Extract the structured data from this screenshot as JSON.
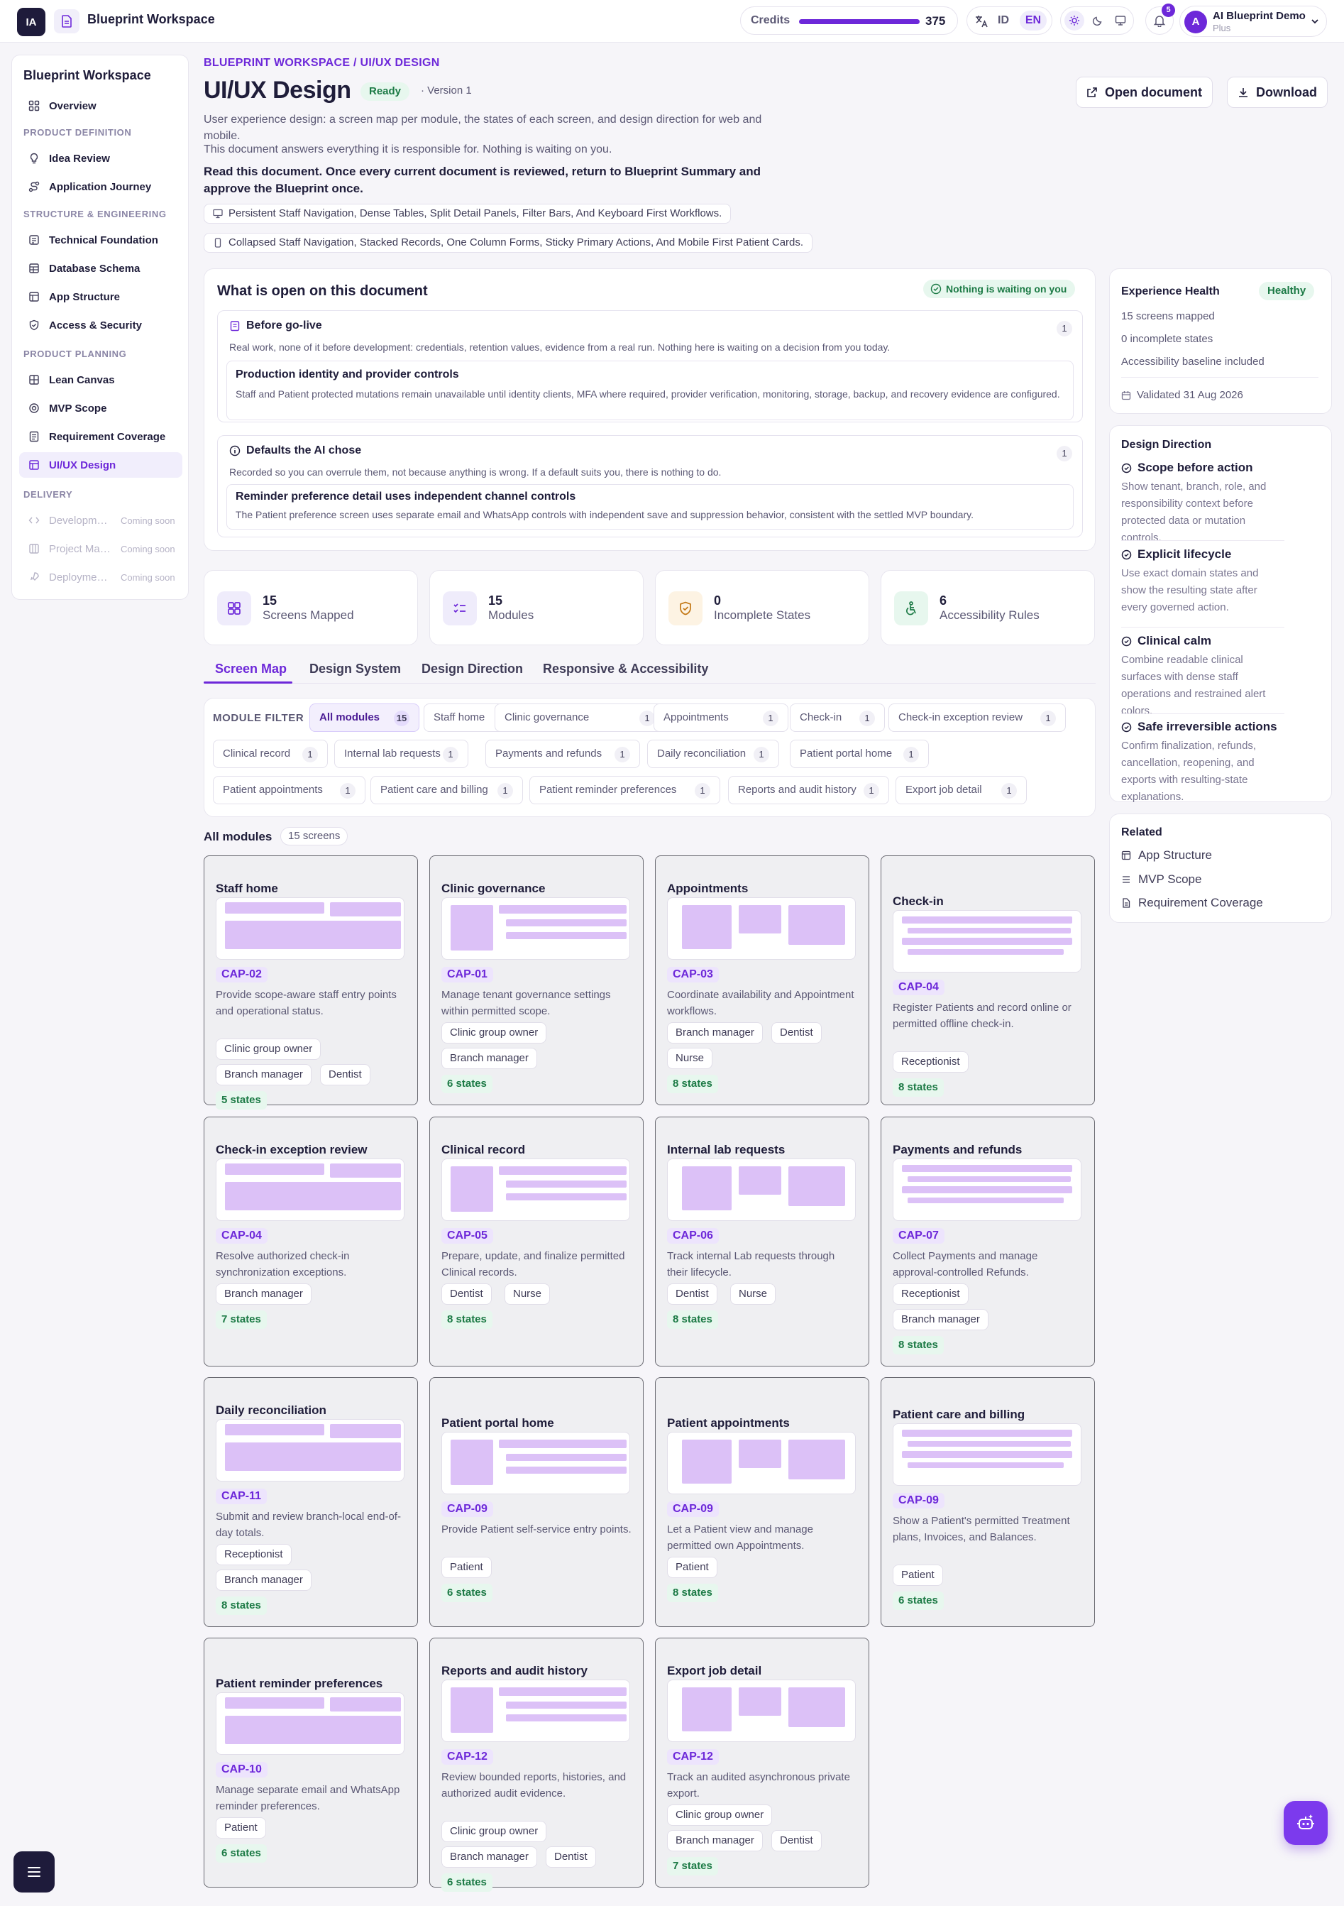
{
  "topbar": {
    "logo": "IA",
    "workspace": "Blueprint Workspace",
    "credits_label": "Credits",
    "credits_value": "375",
    "credits_level": 1.0,
    "lang_id": "ID",
    "lang_en": "EN",
    "notifications": "5",
    "user_initial": "A",
    "user_name": "AI Blueprint Demo",
    "user_plan": "Plus"
  },
  "sidebar": {
    "title": "Blueprint Workspace",
    "overview": "Overview",
    "sections": {
      "product_definition": "PRODUCT DEFINITION",
      "structure": "STRUCTURE & ENGINEERING",
      "planning": "PRODUCT PLANNING",
      "delivery": "DELIVERY"
    },
    "items": {
      "idea_review": "Idea Review",
      "application_journey": "Application Journey",
      "technical_foundation": "Technical Foundation",
      "database_schema": "Database Schema",
      "app_structure": "App Structure",
      "access_security": "Access & Security",
      "lean_canvas": "Lean Canvas",
      "mvp_scope": "MVP Scope",
      "requirement_coverage": "Requirement Coverage",
      "uiux_design": "UI/UX Design"
    },
    "delivery": [
      {
        "label": "Developm…",
        "soon": "Coming soon"
      },
      {
        "label": "Project Ma…",
        "soon": "Coming soon"
      },
      {
        "label": "Deployme…",
        "soon": "Coming soon"
      }
    ]
  },
  "header": {
    "breadcrumb": "BLUEPRINT WORKSPACE / UI/UX DESIGN",
    "title": "UI/UX Design",
    "status": "Ready",
    "version": "· Version 1",
    "open_button": "Open document",
    "download_button": "Download",
    "description": "User experience design: a screen map per module, the states of each screen, and design direction for web and mobile.",
    "description2": "This document answers everything it is responsible for. Nothing is waiting on you.",
    "instruction": "Read this document. Once every current document is reviewed, return to Blueprint Summary and approve the Blueprint once.",
    "desktop_pill": "Persistent Staff Navigation, Dense Tables, Split Detail Panels, Filter Bars, And Keyboard First Workflows.",
    "mobile_pill": "Collapsed Staff Navigation, Stacked Records, One Column Forms, Sticky Primary Actions, And Mobile First Patient Cards."
  },
  "open_items": {
    "title": "What is open on this document",
    "badge": "Nothing is waiting on you",
    "golive": {
      "title": "Before go-live",
      "count": "1",
      "sub": "Real work, none of it before development: credentials, retention values, evidence from a real run. Nothing here is waiting on a decision from you today.",
      "item_title": "Production identity and provider controls",
      "item_body": "Staff and Patient protected mutations remain unavailable until identity clients, MFA where required, provider verification, monitoring, storage, backup, and recovery evidence are configured."
    },
    "defaults": {
      "title": "Defaults the AI chose",
      "count": "1",
      "sub": "Recorded so you can overrule them, not because anything is wrong. If a default suits you, there is nothing to do.",
      "item_title": "Reminder preference detail uses independent channel controls",
      "item_body": "The Patient preference screen uses separate email and WhatsApp controls with independent save and suppression behavior, consistent with the settled MVP boundary."
    }
  },
  "stats": [
    {
      "value": "15",
      "label": "Screens Mapped"
    },
    {
      "value": "15",
      "label": "Modules"
    },
    {
      "value": "0",
      "label": "Incomplete States"
    },
    {
      "value": "6",
      "label": "Accessibility Rules"
    }
  ],
  "tabs": [
    "Screen Map",
    "Design System",
    "Design Direction",
    "Responsive & Accessibility"
  ],
  "filter": {
    "label": "MODULE FILTER",
    "chips": [
      {
        "label": "All modules",
        "count": "15"
      },
      {
        "label": "Staff home",
        "count": "1"
      },
      {
        "label": "Clinic governance",
        "count": "1"
      },
      {
        "label": "Appointments",
        "count": "1"
      },
      {
        "label": "Check-in",
        "count": "1"
      },
      {
        "label": "Check-in exception review",
        "count": "1"
      },
      {
        "label": "Clinical record",
        "count": "1"
      },
      {
        "label": "Internal lab requests",
        "count": "1"
      },
      {
        "label": "Payments and refunds",
        "count": "1"
      },
      {
        "label": "Daily reconciliation",
        "count": "1"
      },
      {
        "label": "Patient portal home",
        "count": "1"
      },
      {
        "label": "Patient appointments",
        "count": "1"
      },
      {
        "label": "Patient care and billing",
        "count": "1"
      },
      {
        "label": "Patient reminder preferences",
        "count": "1"
      },
      {
        "label": "Reports and audit history",
        "count": "1"
      },
      {
        "label": "Export job detail",
        "count": "1"
      }
    ]
  },
  "modules_header": {
    "title": "All modules",
    "count": "15 screens"
  },
  "modules": [
    {
      "title": "Staff home",
      "cap": "CAP-02",
      "desc": "Provide scope-aware staff entry points and operational status.",
      "roles": [
        "Clinic group owner",
        "Branch manager",
        "Dentist"
      ],
      "states": "5 states"
    },
    {
      "title": "Clinic governance",
      "cap": "CAP-01",
      "desc": "Manage tenant governance settings within permitted scope.",
      "roles": [
        "Clinic group owner",
        "Branch manager"
      ],
      "states": "6 states"
    },
    {
      "title": "Appointments",
      "cap": "CAP-03",
      "desc": "Coordinate availability and Appointment workflows.",
      "roles": [
        "Branch manager",
        "Dentist",
        "Nurse"
      ],
      "states": "8 states"
    },
    {
      "title": "Check-in",
      "cap": "CAP-04",
      "desc": "Register Patients and record online or permitted offline check-in.",
      "roles": [
        "Receptionist"
      ],
      "states": "8 states"
    },
    {
      "title": "Check-in exception review",
      "cap": "CAP-04",
      "desc": "Resolve authorized check-in synchronization exceptions.",
      "roles": [
        "Branch manager"
      ],
      "states": "7 states"
    },
    {
      "title": "Clinical record",
      "cap": "CAP-05",
      "desc": "Prepare, update, and finalize permitted Clinical records.",
      "roles": [
        "Dentist",
        "Nurse"
      ],
      "states": "8 states"
    },
    {
      "title": "Internal lab requests",
      "cap": "CAP-06",
      "desc": "Track internal Lab requests through their lifecycle.",
      "roles": [
        "Dentist",
        "Nurse"
      ],
      "states": "8 states"
    },
    {
      "title": "Payments and refunds",
      "cap": "CAP-07",
      "desc": "Collect Payments and manage approval-controlled Refunds.",
      "roles": [
        "Receptionist",
        "Branch manager"
      ],
      "states": "8 states"
    },
    {
      "title": "Daily reconciliation",
      "cap": "CAP-11",
      "desc": "Submit and review branch-local end-of-day totals.",
      "roles": [
        "Receptionist",
        "Branch manager"
      ],
      "states": "8 states"
    },
    {
      "title": "Patient portal home",
      "cap": "CAP-09",
      "desc": "Provide Patient self-service entry points.",
      "roles": [
        "Patient"
      ],
      "states": "6 states"
    },
    {
      "title": "Patient appointments",
      "cap": "CAP-09",
      "desc": "Let a Patient view and manage permitted own Appointments.",
      "roles": [
        "Patient"
      ],
      "states": "8 states"
    },
    {
      "title": "Patient care and billing",
      "cap": "CAP-09",
      "desc": "Show a Patient's permitted Treatment plans, Invoices, and Balances.",
      "roles": [
        "Patient"
      ],
      "states": "6 states"
    },
    {
      "title": "Patient reminder preferences",
      "cap": "CAP-10",
      "desc": "Manage separate email and WhatsApp reminder preferences.",
      "roles": [
        "Patient"
      ],
      "states": "6 states"
    },
    {
      "title": "Reports and audit history",
      "cap": "CAP-12",
      "desc": "Review bounded reports, histories, and authorized audit evidence.",
      "roles": [
        "Clinic group owner",
        "Branch manager",
        "Dentist"
      ],
      "states": "6 states"
    },
    {
      "title": "Export job detail",
      "cap": "CAP-12",
      "desc": "Track an audited asynchronous private export.",
      "roles": [
        "Clinic group owner",
        "Branch manager",
        "Dentist"
      ],
      "states": "7 states"
    }
  ],
  "health": {
    "title": "Experience Health",
    "badge": "Healthy",
    "lines": [
      "15 screens mapped",
      "0 incomplete states",
      "Accessibility baseline included"
    ],
    "validated": "Validated 31 Aug 2026"
  },
  "direction": {
    "title": "Design Direction",
    "items": [
      {
        "title": "Scope before action",
        "body": "Show tenant, branch, role, and responsibility context before protected data or mutation controls."
      },
      {
        "title": "Explicit lifecycle",
        "body": "Use exact domain states and show the resulting state after every governed action."
      },
      {
        "title": "Clinical calm",
        "body": "Combine readable clinical surfaces with dense staff operations and restrained alert colors."
      },
      {
        "title": "Safe irreversible actions",
        "body": "Confirm finalization, refunds, cancellation, reopening, and exports with resulting-state explanations."
      }
    ]
  },
  "related": {
    "title": "Related",
    "items": [
      "App Structure",
      "MVP Scope",
      "Requirement Coverage"
    ]
  },
  "colors": {
    "accent": "#6d28d9",
    "success": "#1c7a45",
    "wire_fill": "#dcc1f7"
  }
}
